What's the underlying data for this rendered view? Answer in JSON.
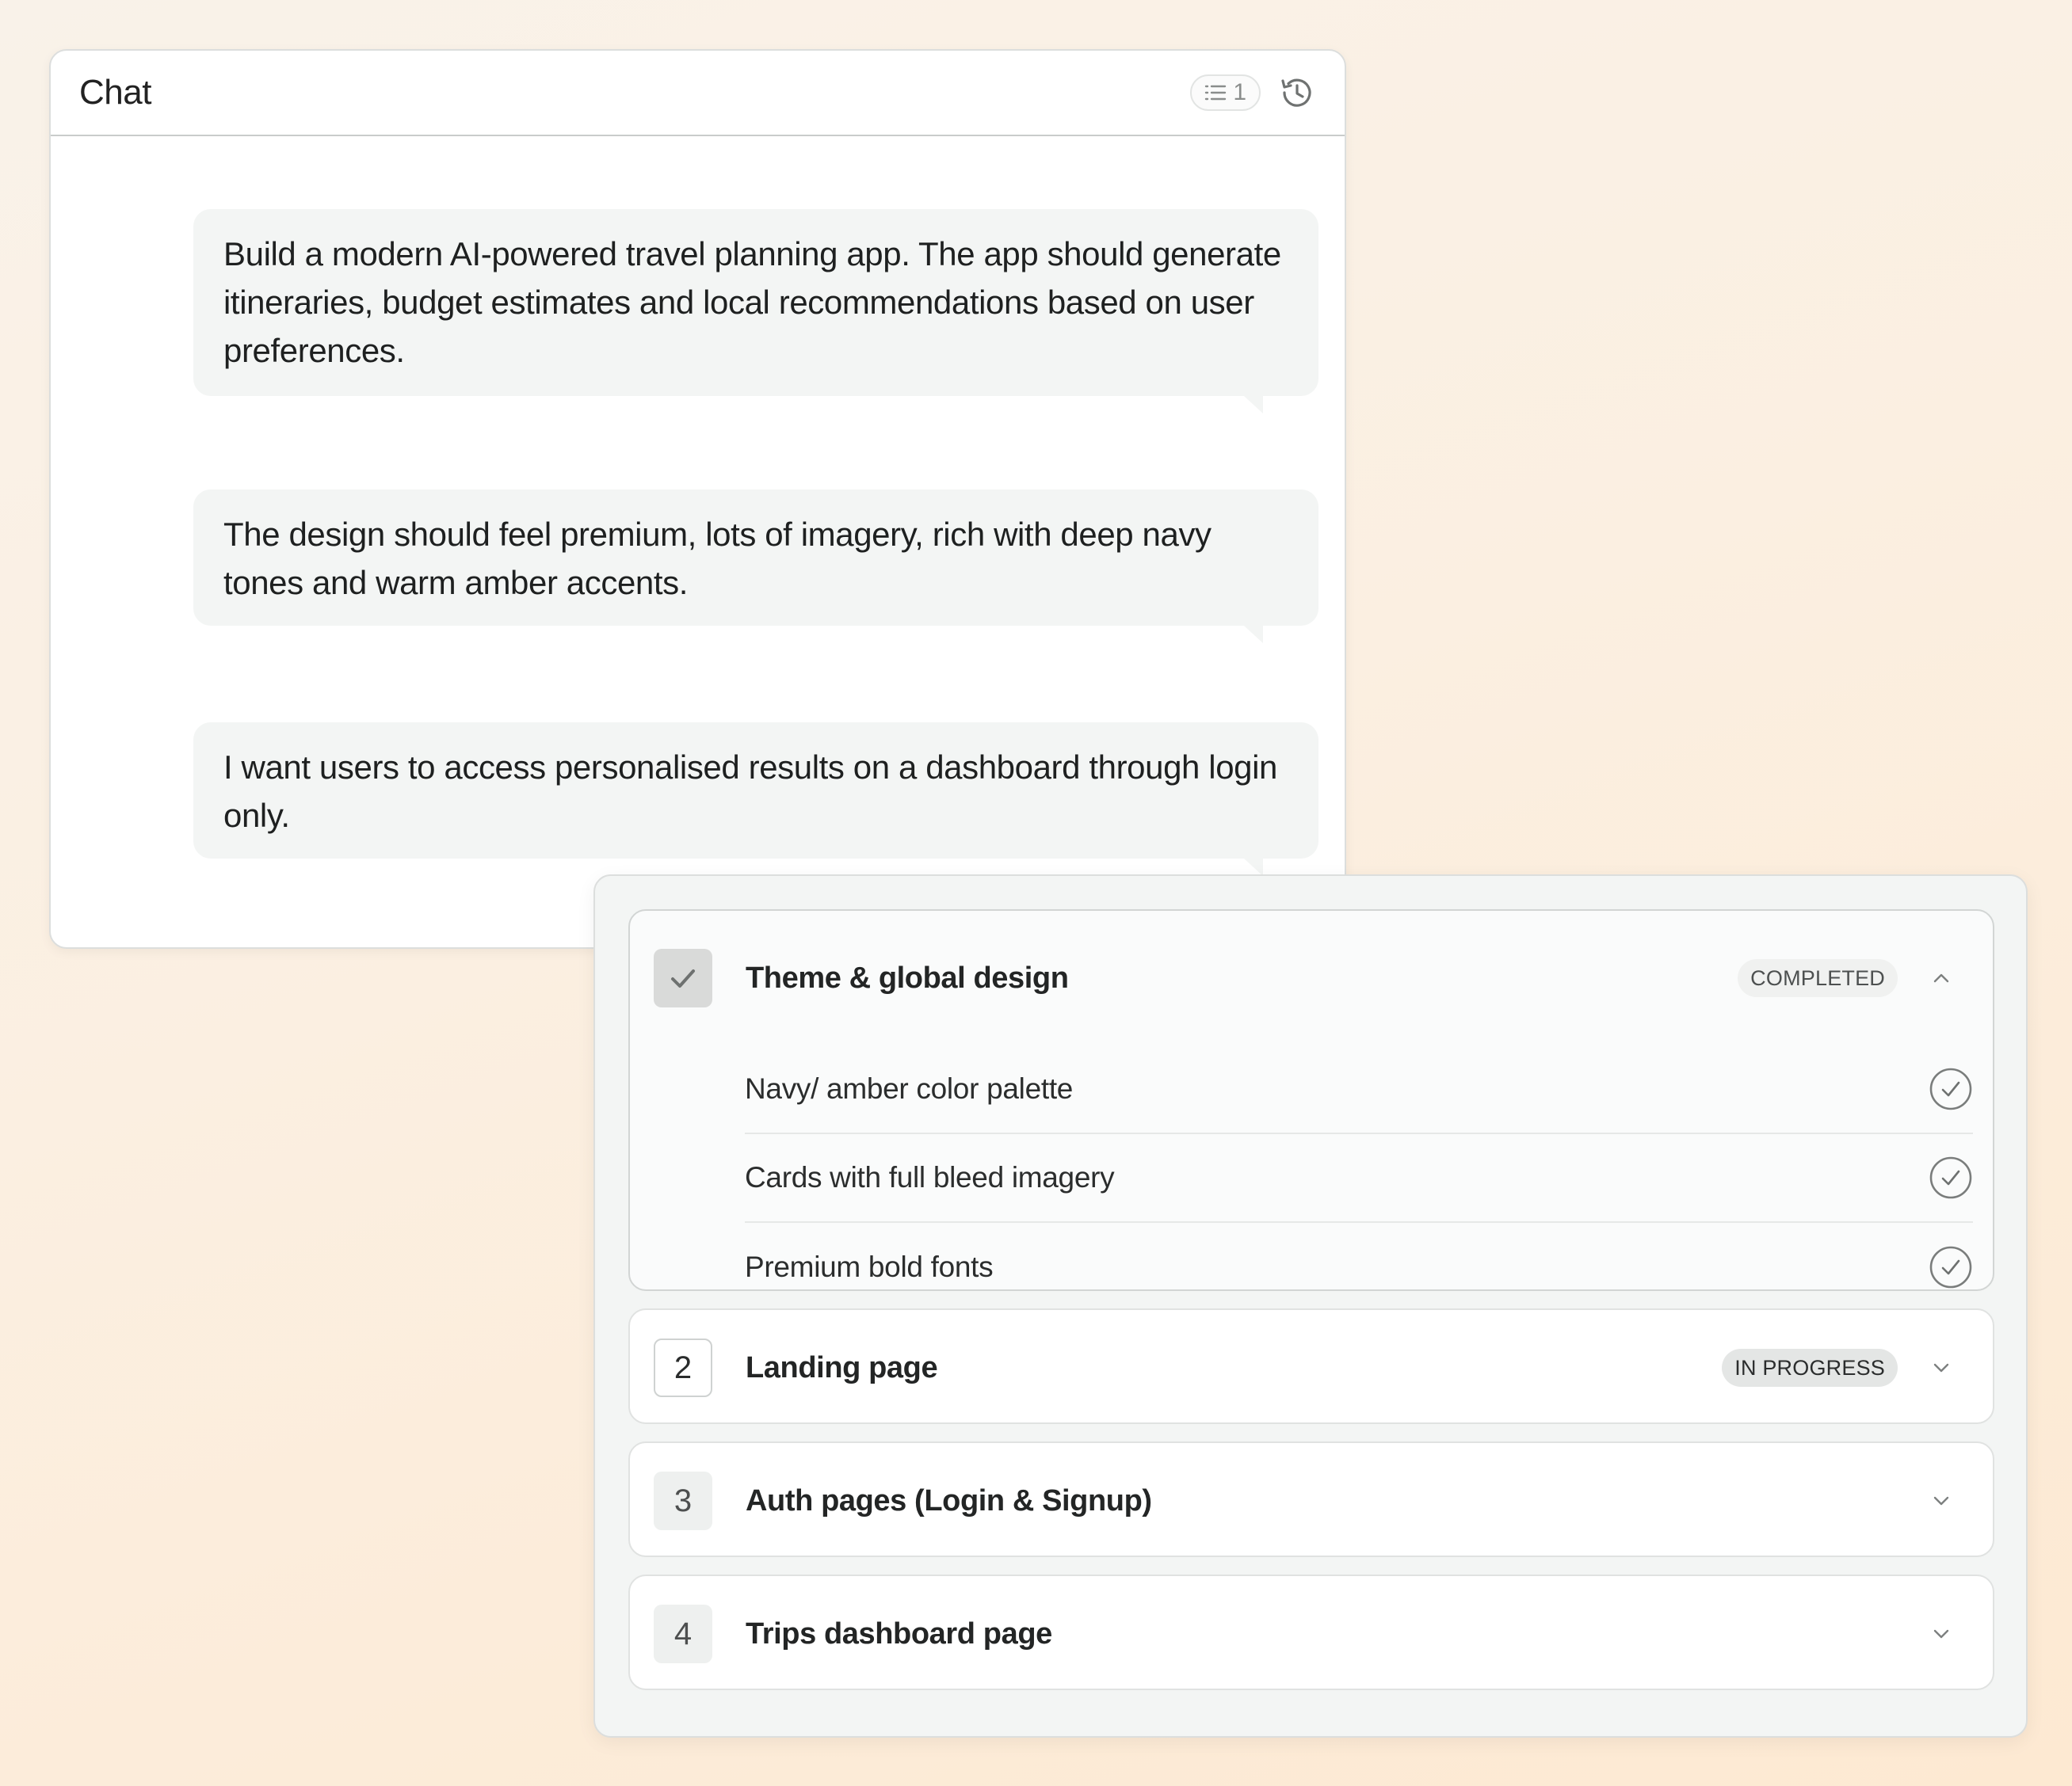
{
  "chat": {
    "title": "Chat",
    "queue_count": "1",
    "messages": [
      "Build a modern AI-powered travel planning app. The app should generate itineraries, budget estimates and local recommendations based on user preferences.",
      "The design should feel premium, lots of imagery, rich with deep navy tones and warm amber accents.",
      "I want users to access personalised results on a dashboard through login only."
    ]
  },
  "plan": {
    "steps": [
      {
        "title": "Theme & global design",
        "status": "COMPLETED",
        "icon": "check-icon",
        "expanded": true,
        "substeps": [
          "Navy/ amber color palette",
          "Cards with full bleed imagery",
          "Premium bold fonts"
        ]
      },
      {
        "number": "2",
        "title": "Landing page",
        "status": "IN PROGRESS",
        "expanded": false
      },
      {
        "number": "3",
        "title": "Auth pages (Login & Signup)",
        "status": "",
        "expanded": false
      },
      {
        "number": "4",
        "title": "Trips dashboard page",
        "status": "",
        "expanded": false
      }
    ]
  }
}
